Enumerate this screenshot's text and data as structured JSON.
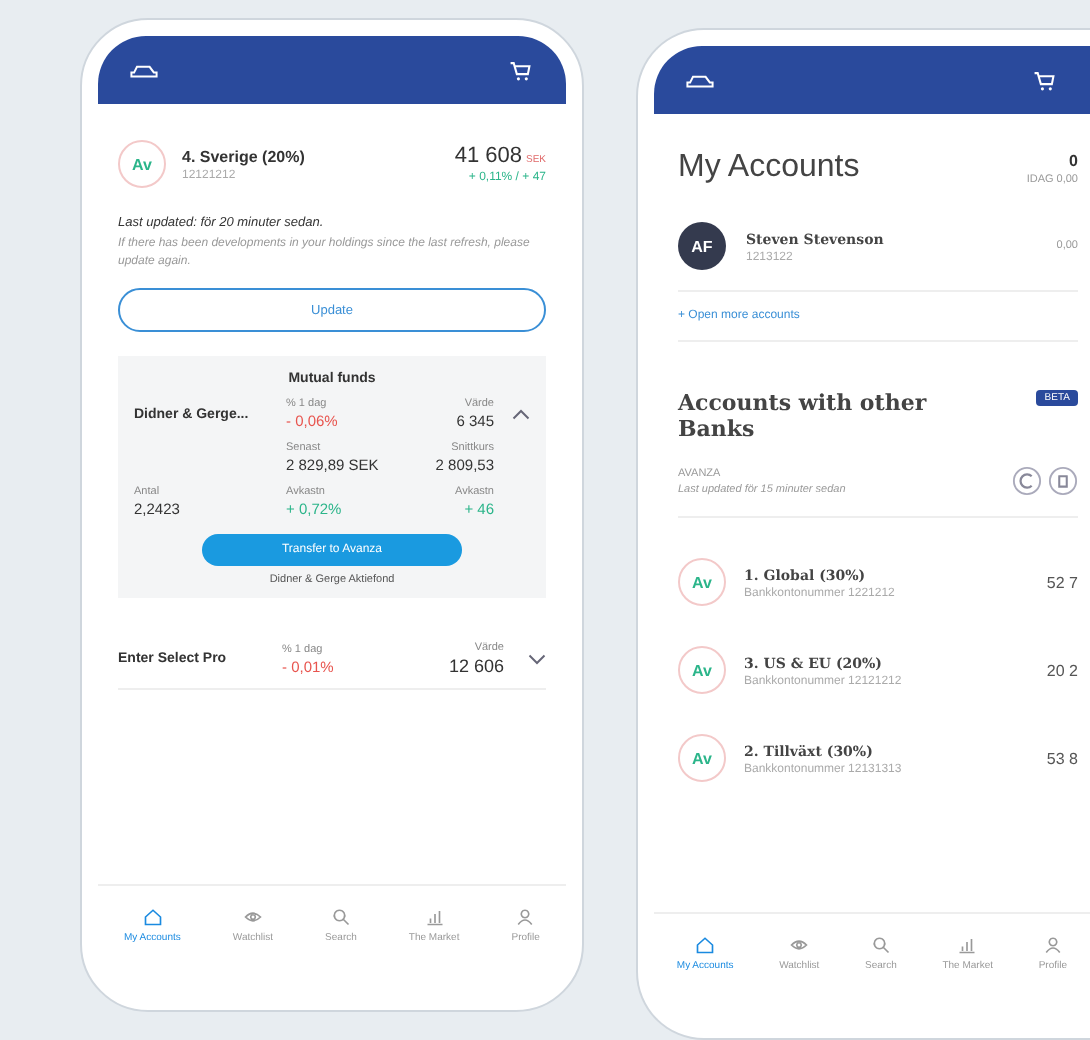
{
  "holding_screen": {
    "account": {
      "avatar": "Av",
      "name": "4. Sverige (20%)",
      "number": "12121212",
      "value": "41 608",
      "currency": "SEK",
      "change": "+ 0,11% / + 47",
      "color": "#2bb58a"
    },
    "updated": "Last updated: för 20 minuter sedan.",
    "notice": "If there has been developments in your holdings since the last refresh, please update again.",
    "update_button": "Update",
    "funds_panel": {
      "title": "Mutual funds",
      "name": "Didner & Gerge...",
      "expanded": true,
      "cells": [
        {
          "label": "% 1 dag",
          "value": "- 0,06%",
          "color": "#e8544e"
        },
        {
          "label": "Värde",
          "value": "6 345",
          "color": "#333333"
        },
        {
          "label": "Senast",
          "value": "2 829,89 SEK",
          "color": "#333333"
        },
        {
          "label": "Snittkurs",
          "value": "2 809,53",
          "color": "#333333"
        },
        {
          "label": "Antal",
          "value": "2,2423",
          "color": "#333333"
        },
        {
          "label": "Avkastn",
          "value": "+ 0,72%",
          "color": "#2bb58a"
        },
        {
          "label": "Avkastn",
          "value": "+ 46",
          "color": "#2bb58a"
        }
      ],
      "transfer_button": "Transfer to Avanza",
      "fund_full_name": "Didner & Gerge Aktiefond"
    },
    "fund_row": {
      "name": "Enter Select Pro",
      "expanded": false,
      "change_label": "% 1 dag",
      "change": "- 0,01%",
      "color": "#e8544e",
      "value_label": "Värde",
      "value": "12 606"
    },
    "nav": [
      {
        "label": "My Accounts",
        "selected": true
      },
      {
        "label": "Watchlist",
        "selected": false
      },
      {
        "label": "Search",
        "selected": false
      },
      {
        "label": "The Market",
        "selected": false
      },
      {
        "label": "Profile",
        "selected": false
      }
    ]
  },
  "accounts_screen": {
    "title": "My Accounts",
    "total": "0",
    "today": "IDAG 0,00",
    "user": {
      "avatar": "AF",
      "name": "Steven Stevenson",
      "number": "1213122",
      "value": "0,00"
    },
    "open_more": "+ Open more accounts",
    "other_banks_title": "Accounts with other Banks",
    "badge": "BETA",
    "bank": "AVANZA",
    "bank_updated": "Last updated för 15 minuter sedan",
    "accounts": [
      {
        "avatar": "Av",
        "name": "1. Global (30%)",
        "number": "Bankkontonummer 1221212",
        "value": "52 7"
      },
      {
        "avatar": "Av",
        "name": "3. US & EU (20%)",
        "number": "Bankkontonummer 12121212",
        "value": "20 2"
      },
      {
        "avatar": "Av",
        "name": "2. Tillväxt (30%)",
        "number": "Bankkontonummer 12131313",
        "value": "53 8"
      }
    ],
    "nav": [
      {
        "label": "My Accounts",
        "selected": true
      },
      {
        "label": "Watchlist",
        "selected": false
      },
      {
        "label": "Search",
        "selected": false
      },
      {
        "label": "The Market",
        "selected": false
      },
      {
        "label": "Profile",
        "selected": false
      }
    ]
  }
}
